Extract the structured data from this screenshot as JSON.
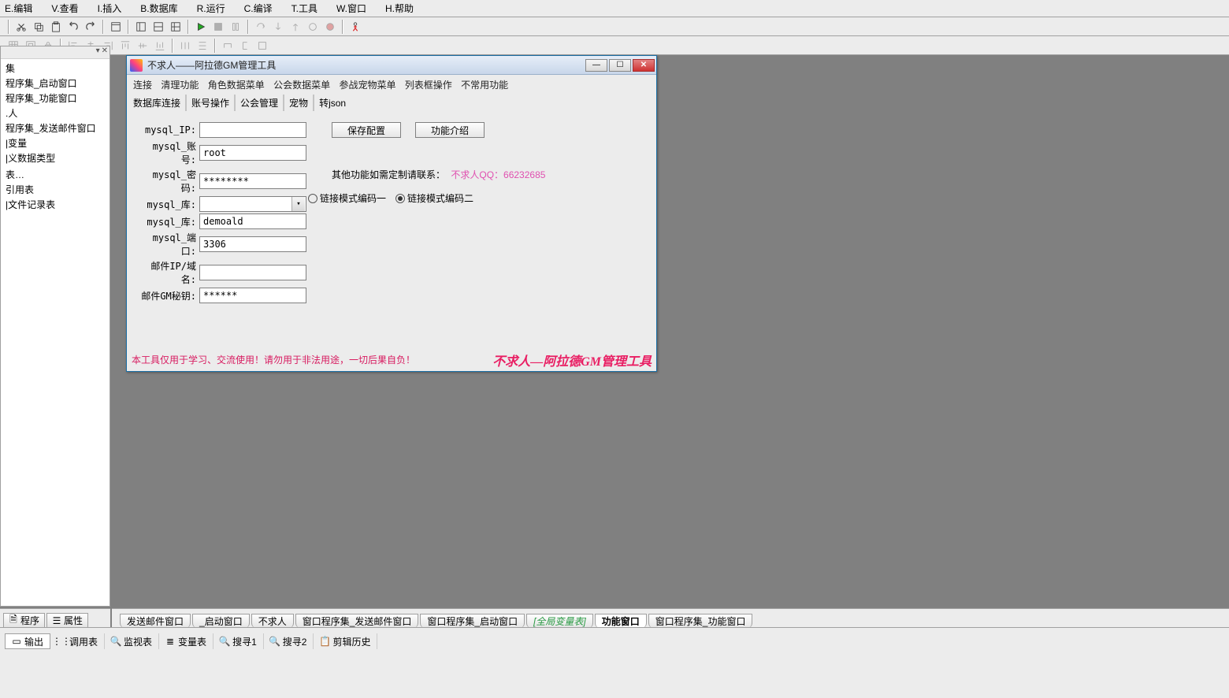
{
  "menubar": {
    "items": [
      "E.编辑",
      "V.查看",
      "I.插入",
      "B.数据库",
      "R.运行",
      "C.编译",
      "T.工具",
      "W.窗口",
      "H.帮助"
    ]
  },
  "sidebar": {
    "items": [
      "集",
      "程序集_启动窗口",
      "程序集_功能窗口",
      ".人",
      "程序集_发送邮件窗口",
      "|变量",
      "|义数据类型",
      "",
      "表…",
      "引用表",
      "|文件记录表"
    ]
  },
  "inner_window": {
    "title": "不求人——阿拉德GM管理工具",
    "menu1": [
      "连接",
      "清理功能",
      "角色数据菜单",
      "公会数据菜单",
      "参战宠物菜单",
      "列表框操作",
      "不常用功能"
    ],
    "tabs": [
      "数据库连接",
      "账号操作",
      "公会管理",
      "宠物",
      "转json"
    ],
    "form": {
      "mysql_ip_label": "mysql_IP:",
      "mysql_ip": "",
      "mysql_acct_label": "mysql_账号:",
      "mysql_acct": "root",
      "mysql_pwd_label": "mysql_密码:",
      "mysql_pwd": "********",
      "mysql_db_label": "mysql_库:",
      "mysql_db": "",
      "mysql_dbt_label": "mysql_库:",
      "mysql_dbt": "demoald",
      "mysql_port_label": "mysql_端口:",
      "mysql_port": "3306",
      "mail_ip_label": "邮件IP/域名:",
      "mail_ip": "",
      "mail_key_label": "邮件GM秘钥:",
      "mail_key": "******"
    },
    "buttons": {
      "save": "保存配置",
      "features": "功能介绍"
    },
    "contact_prefix": "其他功能如需定制请联系：",
    "contact_pink": "不求人QQ：66232685",
    "radio1": "链接模式编码一",
    "radio2": "链接模式编码二",
    "footer_warn": "本工具仅用于学习、交流使用！请勿用于非法用途，一切后果自负！",
    "footer_brand": "不求人—阿拉德GM管理工具"
  },
  "bl_tabs": {
    "program": "程序",
    "props": "属性"
  },
  "mid_tabs": [
    "发送邮件窗口",
    "_启动窗口",
    "不求人",
    "窗口程序集_发送邮件窗口",
    "窗口程序集_启动窗口",
    "[全局变量表]",
    "功能窗口",
    "窗口程序集_功能窗口"
  ],
  "bottom_tabs": [
    "输出",
    "调用表",
    "监视表",
    "变量表",
    "搜寻1",
    "搜寻2",
    "剪辑历史"
  ]
}
